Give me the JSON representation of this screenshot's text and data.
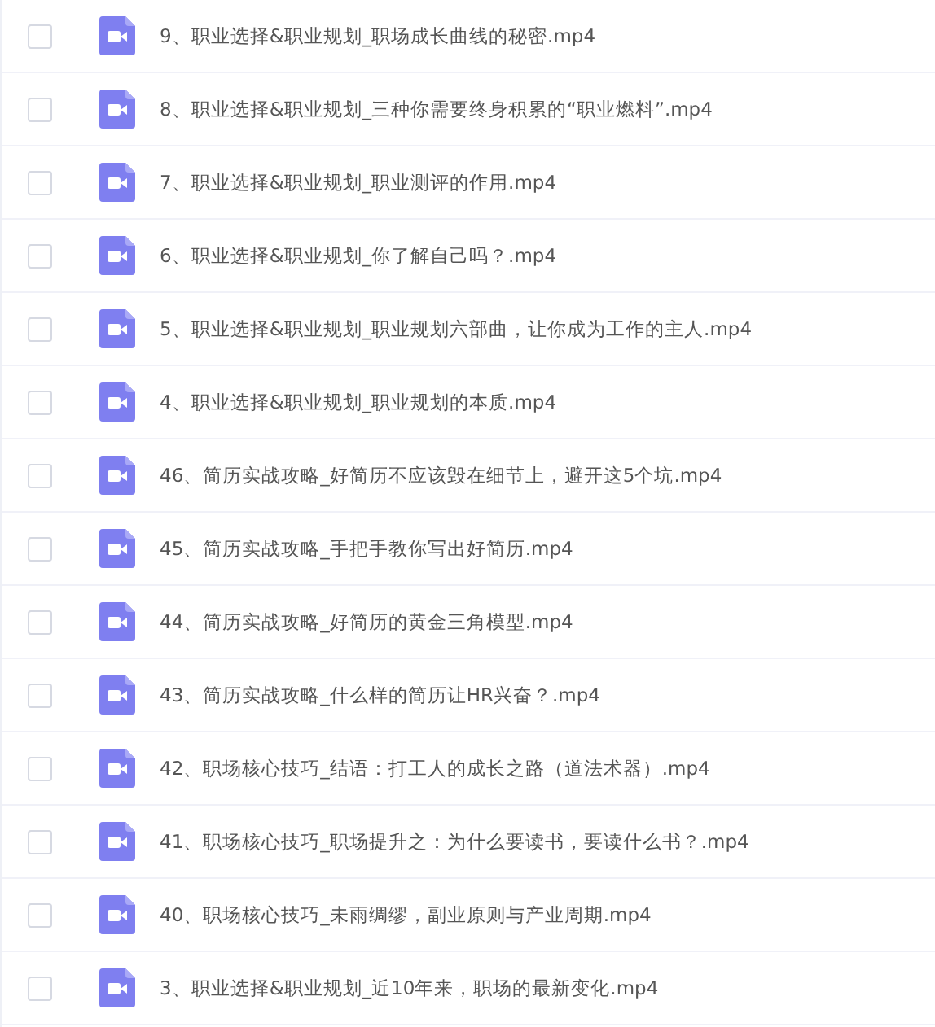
{
  "files": [
    {
      "name": "9、职业选择&职业规划_职场成长曲线的秘密.mp4",
      "checked": false
    },
    {
      "name": "8、职业选择&职业规划_三种你需要终身积累的“职业燃料”.mp4",
      "checked": false
    },
    {
      "name": "7、职业选择&职业规划_职业测评的作用.mp4",
      "checked": false
    },
    {
      "name": "6、职业选择&职业规划_你了解自己吗？.mp4",
      "checked": false
    },
    {
      "name": "5、职业选择&职业规划_职业规划六部曲，让你成为工作的主人.mp4",
      "checked": false
    },
    {
      "name": "4、职业选择&职业规划_职业规划的本质.mp4",
      "checked": false
    },
    {
      "name": "46、简历实战攻略_好简历不应该毁在细节上，避开这5个坑.mp4",
      "checked": false
    },
    {
      "name": "45、简历实战攻略_手把手教你写出好简历.mp4",
      "checked": false
    },
    {
      "name": "44、简历实战攻略_好简历的黄金三角模型.mp4",
      "checked": false
    },
    {
      "name": "43、简历实战攻略_什么样的简历让HR兴奋？.mp4",
      "checked": false
    },
    {
      "name": "42、职场核心技巧_结语：打工人的成长之路（道法术器）.mp4",
      "checked": false
    },
    {
      "name": "41、职场核心技巧_职场提升之：为什么要读书，要读什么书？.mp4",
      "checked": false
    },
    {
      "name": "40、职场核心技巧_未雨绸缪，副业原则与产业周期.mp4",
      "checked": false
    },
    {
      "name": "3、职业选择&职业规划_近10年来，职场的最新变化.mp4",
      "checked": false
    }
  ]
}
